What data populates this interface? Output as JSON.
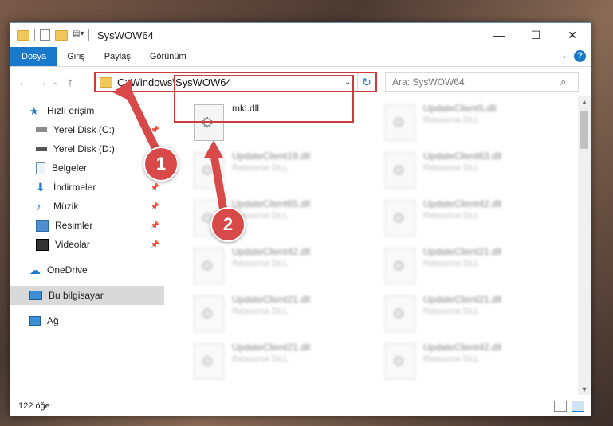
{
  "window": {
    "title": "SysWOW64"
  },
  "ribbon": {
    "tabs": [
      "Dosya",
      "Giriş",
      "Paylaş",
      "Görünüm"
    ],
    "help": "?"
  },
  "address": {
    "path": "C:\\Windows\\SysWOW64"
  },
  "search": {
    "placeholder": "Ara: SysWOW64"
  },
  "sidebar": {
    "items": [
      {
        "label": "Hızlı erişim",
        "icon": "star-icon"
      },
      {
        "label": "Yerel Disk (C:)",
        "icon": "drive-icon",
        "pinned": true
      },
      {
        "label": "Yerel Disk (D:)",
        "icon": "drive-icon"
      },
      {
        "label": "Belgeler",
        "icon": "documents-icon",
        "pinned": true
      },
      {
        "label": "İndirmeler",
        "icon": "download-icon",
        "pinned": true
      },
      {
        "label": "Müzik",
        "icon": "music-icon",
        "pinned": true
      },
      {
        "label": "Resimler",
        "icon": "pictures-icon",
        "pinned": true
      },
      {
        "label": "Videolar",
        "icon": "video-icon",
        "pinned": true
      },
      {
        "label": "OneDrive",
        "icon": "cloud-icon"
      },
      {
        "label": "Bu bilgisayar",
        "icon": "computer-icon",
        "selected": true
      },
      {
        "label": "Ağ",
        "icon": "network-icon"
      }
    ]
  },
  "files": [
    {
      "name": "mkl.dll",
      "type": ""
    },
    {
      "name": "UpdateClient5.dll",
      "type": "Resource DLL"
    },
    {
      "name": "UpdateClient19.dll",
      "type": "Resource DLL"
    },
    {
      "name": "UpdateClient63.dll",
      "type": "Resource DLL"
    },
    {
      "name": "UpdateClient65.dll",
      "type": "Resource DLL"
    },
    {
      "name": "UpdateClient42.dll",
      "type": "Resource DLL"
    },
    {
      "name": "UpdateClient42.dll",
      "type": "Resource DLL"
    },
    {
      "name": "UpdateClient21.dll",
      "type": "Resource DLL"
    },
    {
      "name": "UpdateClient21.dll",
      "type": "Resource DLL"
    },
    {
      "name": "UpdateClient21.dll",
      "type": "Resource DLL"
    },
    {
      "name": "UpdateClient21.dll",
      "type": "Resource DLL"
    },
    {
      "name": "UpdateClient42.dll",
      "type": "Resource DLL"
    }
  ],
  "status": {
    "count": "122 öğe"
  },
  "callouts": [
    "1",
    "2"
  ],
  "colors": {
    "accent": "#1979ca",
    "highlight": "#d03a3a"
  }
}
